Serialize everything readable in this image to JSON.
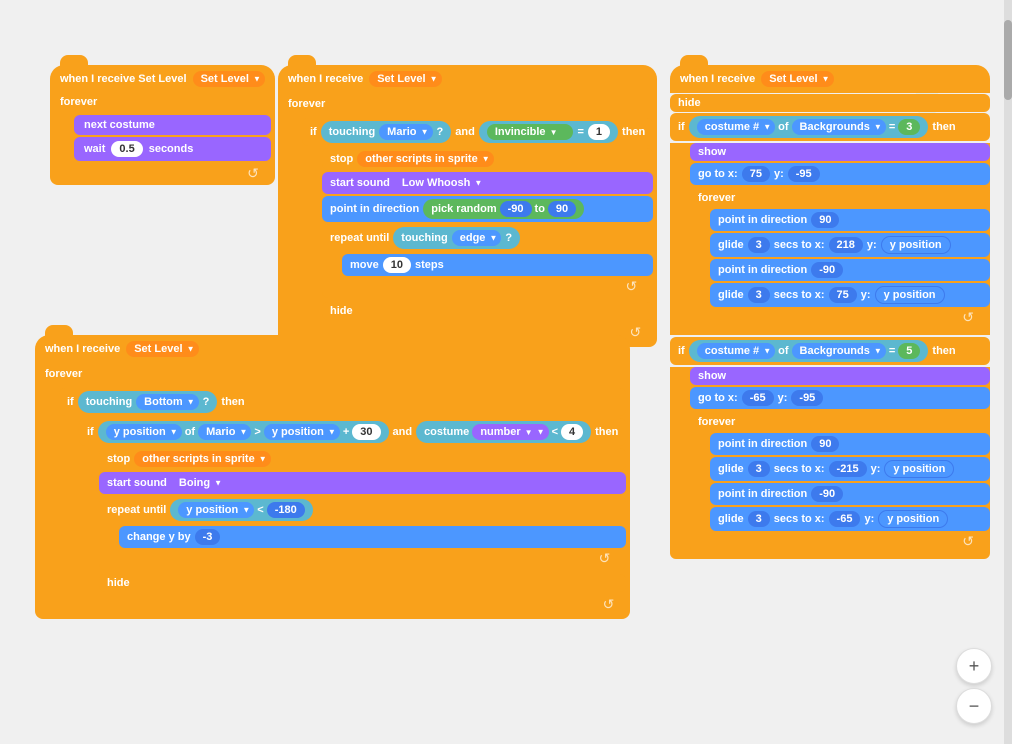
{
  "canvas": {
    "background": "#f0f0f0"
  },
  "blocks": {
    "group1": {
      "title": "when I receive Set Level",
      "forever": "forever",
      "nextCostume": "next costume",
      "wait": "wait",
      "waitVal": "0.5",
      "seconds": "seconds"
    },
    "group2": {
      "title": "when I receive Set Level",
      "forever": "forever",
      "if": "if",
      "touching": "touching",
      "mario": "Mario",
      "and": "and",
      "invincible": "Invincible",
      "equals": "=",
      "val1": "1",
      "then": "then",
      "stop": "stop",
      "otherScripts": "other scripts in sprite",
      "startSound": "start sound",
      "sound": "Low Whoosh",
      "pointInDirection": "point in direction",
      "pickRandom": "pick random",
      "from": "-90",
      "to": "90",
      "repeatUntil": "repeat until",
      "touchingEdge": "touching",
      "edge": "edge",
      "question": "?",
      "move": "move",
      "steps": "10",
      "stepsLabel": "steps",
      "hide": "hide"
    },
    "group3": {
      "title": "when I receive Set Level",
      "forever": "forever",
      "if": "if",
      "touching": "touching",
      "bottom": "Bottom",
      "question": "?",
      "then": "then",
      "if2": "if",
      "yPosition": "y position",
      "of": "of",
      "mario": "Mario",
      "gt": ">",
      "yPosition2": "y position",
      "plus": "+",
      "val30": "30",
      "and": "and",
      "costume": "costume",
      "number": "number",
      "lt": "<",
      "val4": "4",
      "then2": "then",
      "stop": "stop",
      "otherScripts": "other scripts in sprite",
      "startSound": "start sound",
      "boing": "Boing",
      "repeatUntil": "repeat until",
      "yPositionDrop": "y position",
      "lt2": "<",
      "val180": "-180",
      "changeY": "change y by",
      "valNeg3": "-3",
      "hide": "hide"
    },
    "group4": {
      "title": "when I receive Set Level",
      "hide": "hide",
      "if": "if",
      "costume": "costume #",
      "of": "of",
      "backgrounds": "Backgrounds",
      "eq": "=",
      "val3": "3",
      "then": "then",
      "show": "show",
      "goTo": "go to x:",
      "x": "75",
      "y": "-95",
      "forever": "forever",
      "pointInDir90": "point in direction",
      "dir90": "90",
      "glide1": "glide",
      "glide1Secs": "3",
      "secs": "secs to x:",
      "glide1X": "218",
      "yLabel": "y:",
      "yPos": "y position",
      "pointDirNeg90": "point in direction",
      "dirNeg90": "-90",
      "glide2": "glide",
      "glide2Secs": "3",
      "secs2": "secs to x:",
      "glide2X": "75",
      "yLabel2": "y:",
      "yPos2": "y position"
    },
    "group5": {
      "if": "if",
      "costume": "costume #",
      "of": "of",
      "backgrounds": "Backgrounds",
      "eq": "=",
      "val5": "5",
      "then": "then",
      "show": "show",
      "goTo": "go to x:",
      "x": "-65",
      "y": "-95",
      "forever": "forever",
      "pointInDir90": "point in direction",
      "dir90": "90",
      "glide1": "glide",
      "glide1Secs": "3",
      "secs": "secs to x:",
      "glide1X": "-215",
      "yLabel": "y:",
      "yPos": "y position",
      "pointDirNeg90": "point in direction",
      "dirNeg90": "-90",
      "glide2": "glide",
      "glide2Secs": "3",
      "secs2": "secs to x:",
      "glide2X": "-65",
      "yLabel2": "y:",
      "yPos2": "y position"
    }
  },
  "zoom": {
    "in": "+",
    "out": "−"
  }
}
